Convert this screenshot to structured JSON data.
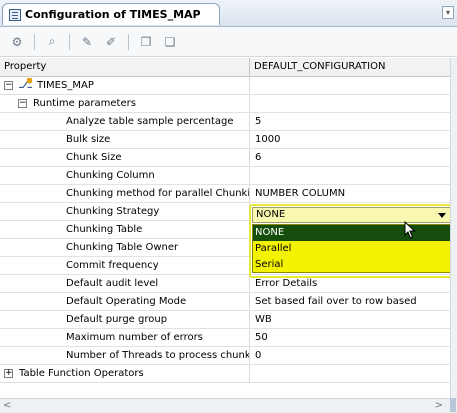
{
  "tab": {
    "title": "Configuration of TIMES_MAP",
    "menu_icon": "chevron-down-icon"
  },
  "toolbar": {
    "icons": [
      "properties-icon",
      "search-icon",
      "edit-icon",
      "find-icon",
      "copy-icon",
      "paste-icon"
    ]
  },
  "table": {
    "header_property": "Property",
    "header_value": "DEFAULT_CONFIGURATION"
  },
  "rows": [
    {
      "name": "TIMES_MAP",
      "value": ""
    },
    {
      "name": "Runtime parameters",
      "value": ""
    },
    {
      "name": "Analyze table sample percentage",
      "value": "5"
    },
    {
      "name": "Bulk size",
      "value": "1000"
    },
    {
      "name": "Chunk Size",
      "value": "6"
    },
    {
      "name": "Chunking Column",
      "value": ""
    },
    {
      "name": "Chunking method for parallel Chunking",
      "value": "NUMBER COLUMN"
    },
    {
      "name": "Chunking Strategy",
      "value": "NONE"
    },
    {
      "name": "Chunking Table",
      "value": ""
    },
    {
      "name": "Chunking Table Owner",
      "value": ""
    },
    {
      "name": "Commit frequency",
      "value": ""
    },
    {
      "name": "Default audit level",
      "value": "Error Details"
    },
    {
      "name": "Default Operating Mode",
      "value": "Set based fail over to row based"
    },
    {
      "name": "Default purge group",
      "value": "WB"
    },
    {
      "name": "Maximum number of errors",
      "value": "50"
    },
    {
      "name": "Number of Threads to process chunks",
      "value": "0"
    },
    {
      "name": "Table Function Operators",
      "value": ""
    }
  ],
  "dropdown": {
    "selected": "NONE",
    "options": [
      "NONE",
      "Parallel",
      "Serial"
    ]
  },
  "colors": {
    "highlight": "#f3f200",
    "selected_option": "#154d0c"
  }
}
